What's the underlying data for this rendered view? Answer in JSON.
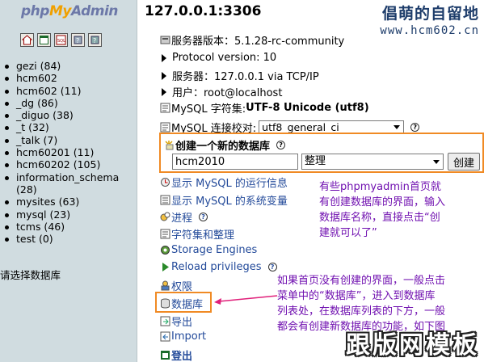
{
  "left": {
    "logo": {
      "php": "php",
      "my": "My",
      "admin": "Admin"
    },
    "nav_icons": [
      "home-icon",
      "sql-window-icon",
      "sql-query-icon",
      "docs-icon",
      "help-icon"
    ],
    "databases": [
      "gezi (84)",
      "hcm602",
      "hcm602 (11)",
      "_dg (86)",
      "_diguo (38)",
      "_t (32)",
      "_talk (7)",
      "hcm60201 (11)",
      "hcm60202 (105)",
      "information_schema",
      "(28)",
      "mysites (63)",
      "mysql (23)",
      "tcms (46)",
      "test (0)"
    ],
    "select_prompt": "请选择数据库"
  },
  "right": {
    "server_title": "127.0.0.1:3306",
    "watermark_cn": "倡萌的自留地",
    "watermark_url": "www.hcm602.cn",
    "server_version": "服务器版本：5.1.28-rc-community",
    "protocol": "Protocol version: 10",
    "server": "服务器：127.0.0.1 via TCP/IP",
    "user": "用户：root@localhost",
    "charset_label": "MySQL 字符集: ",
    "charset_value": "UTF-8 Unicode (utf8)",
    "collation_label": "MySQL 连接校对:",
    "collation_value": "utf8_general_ci",
    "create_db": {
      "label": "创建一个新的数据库",
      "input_value": "hcm2010",
      "collation": "整理",
      "button": "创建"
    },
    "links": [
      {
        "icon": "process-icon",
        "text": "显示 MySQL 的运行信息"
      },
      {
        "icon": "variables-icon",
        "text": "显示 MySQL 的系统变量"
      },
      {
        "icon": "processes-icon",
        "text": "进程"
      },
      {
        "icon": "charset-icon",
        "text": "字符集和整理"
      },
      {
        "icon": "engines-icon",
        "text": "Storage Engines"
      },
      {
        "icon": "reload-icon",
        "text": "Reload privileges"
      },
      {
        "icon": "privileges-icon",
        "text": "权限"
      },
      {
        "icon": "databases-icon",
        "text": "数据库"
      },
      {
        "icon": "export-icon",
        "text": "导出"
      },
      {
        "icon": "import-icon",
        "text": "Import"
      },
      {
        "icon": "logout-icon",
        "text": "登出"
      }
    ],
    "annotation_1": [
      "有些phpmyadmin首页就",
      "有创建数据库的界面，输入",
      "数据库名称，直接点击“创",
      "建就可以了”"
    ],
    "annotation_2": [
      "如果首页没有创建的界面，一般点击",
      "菜单中的“数据库”，进入到数据库",
      "列表处，在数据库列表的下方，一般",
      "都会有创建新数据库的功能，如下图"
    ],
    "watermark_bottom": "跟版网模板"
  },
  "colors": {
    "left_bg": "#d0dce0",
    "highlight": "#f08a24",
    "annotation": "#7010b0",
    "link": "#234a9a"
  }
}
